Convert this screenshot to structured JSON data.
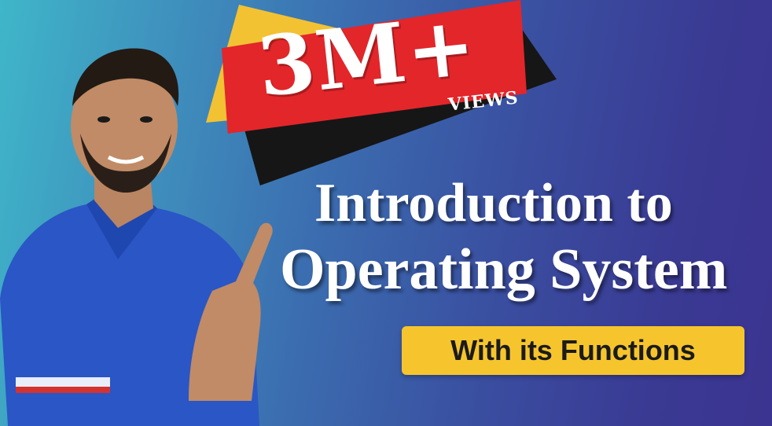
{
  "badge": {
    "big_text": "3M+",
    "small_text": "VIEWS"
  },
  "title": {
    "line1": "Introduction to",
    "line2": "Operating System"
  },
  "subtitle": "With its Functions",
  "colors": {
    "badge_red": "#e2262a",
    "badge_yellow": "#f2c232",
    "badge_black": "#161616",
    "subtitle_bg": "#f6c52d",
    "shirt_blue": "#2a56c6"
  },
  "presenter": {
    "description_icon": "presenter-pointing-icon"
  }
}
